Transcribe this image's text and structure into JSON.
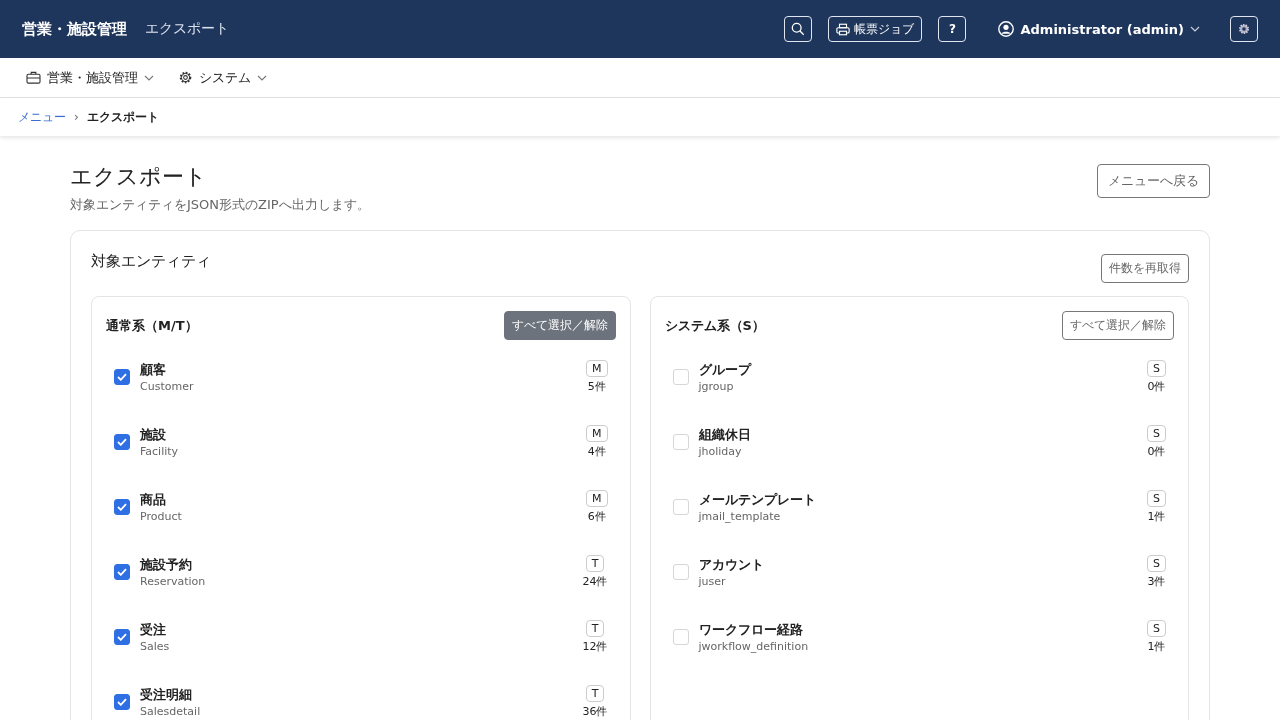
{
  "header": {
    "app_title": "営業・施設管理",
    "page_title": "エクスポート",
    "jobs_button": "帳票ジョブ",
    "help_button": "?",
    "user": "Administrator (admin)"
  },
  "nav": [
    {
      "label": "営業・施設管理"
    },
    {
      "label": "システム"
    }
  ],
  "breadcrumb": {
    "link": "メニュー",
    "separator": "›",
    "current": "エクスポート"
  },
  "page": {
    "title": "エクスポート",
    "description": "対象エンティティをJSON形式のZIPへ出力します。",
    "back_button": "メニューへ戻る"
  },
  "card": {
    "title": "対象エンティティ",
    "refresh_button": "件数を再取得",
    "groups": [
      {
        "title": "通常系（M/T）",
        "toggle_button": "すべて選択／解除",
        "kind": "filled",
        "items": [
          {
            "name": "顧客",
            "code": "Customer",
            "type": "M",
            "count": "5件",
            "checked": true
          },
          {
            "name": "施設",
            "code": "Facility",
            "type": "M",
            "count": "4件",
            "checked": true
          },
          {
            "name": "商品",
            "code": "Product",
            "type": "M",
            "count": "6件",
            "checked": true
          },
          {
            "name": "施設予約",
            "code": "Reservation",
            "type": "T",
            "count": "24件",
            "checked": true
          },
          {
            "name": "受注",
            "code": "Sales",
            "type": "T",
            "count": "12件",
            "checked": true
          },
          {
            "name": "受注明細",
            "code": "Salesdetail",
            "type": "T",
            "count": "36件",
            "checked": true
          }
        ]
      },
      {
        "title": "システム系（S）",
        "toggle_button": "すべて選択／解除",
        "kind": "outline",
        "items": [
          {
            "name": "グループ",
            "code": "jgroup",
            "type": "S",
            "count": "0件",
            "checked": false
          },
          {
            "name": "組織休日",
            "code": "jholiday",
            "type": "S",
            "count": "0件",
            "checked": false
          },
          {
            "name": "メールテンプレート",
            "code": "jmail_template",
            "type": "S",
            "count": "1件",
            "checked": false
          },
          {
            "name": "アカウント",
            "code": "juser",
            "type": "S",
            "count": "3件",
            "checked": false
          },
          {
            "name": "ワークフロー経路",
            "code": "jworkflow_definition",
            "type": "S",
            "count": "1件",
            "checked": false
          }
        ]
      }
    ]
  }
}
